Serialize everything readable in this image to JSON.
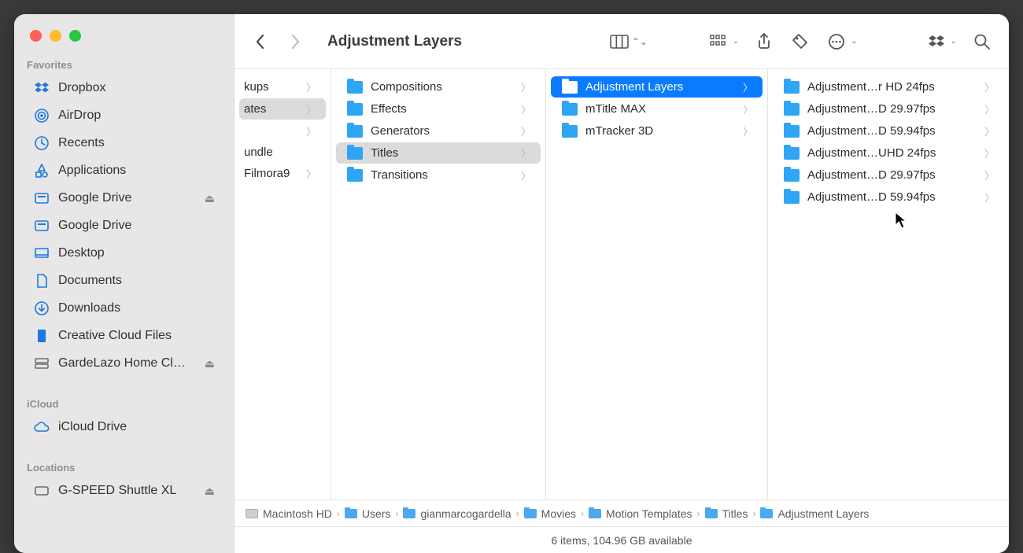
{
  "window_title": "Adjustment Layers",
  "sidebar": {
    "favorites_label": "Favorites",
    "icloud_label": "iCloud",
    "locations_label": "Locations",
    "favorites": [
      {
        "label": "Dropbox",
        "icon": "dropbox"
      },
      {
        "label": "AirDrop",
        "icon": "airdrop"
      },
      {
        "label": "Recents",
        "icon": "recents"
      },
      {
        "label": "Applications",
        "icon": "apps"
      },
      {
        "label": "Google Drive",
        "icon": "drive",
        "eject": true
      },
      {
        "label": "Google Drive",
        "icon": "drive"
      },
      {
        "label": "Desktop",
        "icon": "desktop"
      },
      {
        "label": "Documents",
        "icon": "docs"
      },
      {
        "label": "Downloads",
        "icon": "downloads"
      },
      {
        "label": "Creative Cloud Files",
        "icon": "ccf"
      },
      {
        "label": "GardeLazo Home Cl…",
        "icon": "server",
        "eject": true
      }
    ],
    "icloud": [
      {
        "label": "iCloud Drive",
        "icon": "cloud"
      }
    ],
    "locations": [
      {
        "label": "G-SPEED Shuttle XL",
        "icon": "hd",
        "eject": true
      }
    ]
  },
  "columns": {
    "c0": [
      {
        "label": "kups",
        "type": "folder",
        "arrow": true
      },
      {
        "label": "ates",
        "type": "folder",
        "arrow": true,
        "path": true
      },
      {
        "label": "",
        "type": "folder",
        "arrow": true
      },
      {
        "label": "undle",
        "type": "app"
      },
      {
        "label": "Filmora9",
        "type": "app",
        "arrow": true
      }
    ],
    "c1": [
      {
        "label": "Compositions",
        "type": "folder",
        "arrow": true
      },
      {
        "label": "Effects",
        "type": "folder",
        "arrow": true
      },
      {
        "label": "Generators",
        "type": "folder",
        "arrow": true
      },
      {
        "label": "Titles",
        "type": "folder",
        "arrow": true,
        "path": true
      },
      {
        "label": "Transitions",
        "type": "folder",
        "arrow": true
      }
    ],
    "c2": [
      {
        "label": "Adjustment Layers",
        "type": "folder",
        "arrow": true,
        "selected": true
      },
      {
        "label": "mTitle MAX",
        "type": "folder",
        "arrow": true
      },
      {
        "label": "mTracker 3D",
        "type": "folder",
        "arrow": true
      }
    ],
    "c3": [
      {
        "label": "Adjustment…r HD 24fps",
        "type": "folder",
        "arrow": true
      },
      {
        "label": "Adjustment…D 29.97fps",
        "type": "folder",
        "arrow": true
      },
      {
        "label": "Adjustment…D 59.94fps",
        "type": "folder",
        "arrow": true
      },
      {
        "label": "Adjustment…UHD 24fps",
        "type": "folder",
        "arrow": true
      },
      {
        "label": "Adjustment…D 29.97fps",
        "type": "folder",
        "arrow": true
      },
      {
        "label": "Adjustment…D 59.94fps",
        "type": "folder",
        "arrow": true
      }
    ]
  },
  "pathbar": [
    {
      "label": "Macintosh HD",
      "icon": "hd"
    },
    {
      "label": "Users",
      "icon": "folder"
    },
    {
      "label": "gianmarcogardella",
      "icon": "folder"
    },
    {
      "label": "Movies",
      "icon": "folder"
    },
    {
      "label": "Motion Templates",
      "icon": "folder"
    },
    {
      "label": "Titles",
      "icon": "folder"
    },
    {
      "label": "Adjustment Layers",
      "icon": "folder"
    }
  ],
  "status": "6 items, 104.96 GB available"
}
